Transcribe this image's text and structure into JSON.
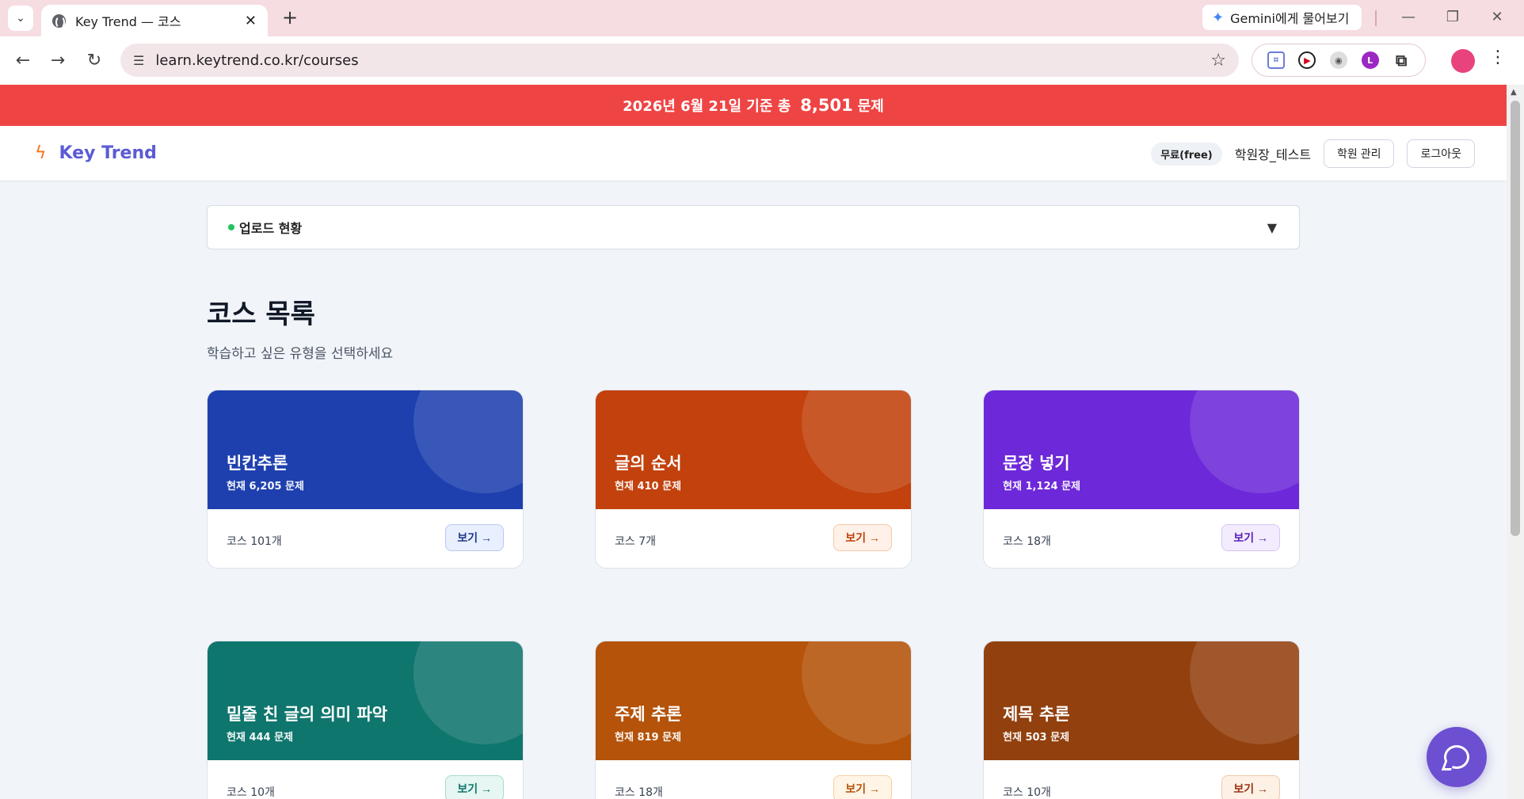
{
  "browser": {
    "tab_title": "Key Trend — 코스",
    "url": "learn.keytrend.co.kr/courses",
    "gemini_label": "Gemini에게 물어보기"
  },
  "banner": {
    "prefix": "2026년 6월 21일 기준 총",
    "count": "8,501",
    "suffix": "문제"
  },
  "header": {
    "logo": "Key Trend",
    "plan": "무료(free)",
    "user": "학원장_테스트",
    "manage_btn": "학원 관리",
    "logout_btn": "로그아웃"
  },
  "upload": {
    "label": "업로드 현황"
  },
  "page": {
    "title": "코스 목록",
    "subtitle": "학습하고 싶은 유형을 선택하세요"
  },
  "courses": [
    {
      "title": "빈칸추론",
      "count": "현재 6,205 문제",
      "courses": "코스 101개",
      "button": "보기 →",
      "color": "#1e40af",
      "btn_bg": "#e8efff",
      "btn_fg": "#1e3a8a",
      "btn_border": "#b8c8ef"
    },
    {
      "title": "글의 순서",
      "count": "현재 410 문제",
      "courses": "코스 7개",
      "button": "보기 →",
      "color": "#c2410c",
      "btn_bg": "#fff1e8",
      "btn_fg": "#c2410c",
      "btn_border": "#f6c6a8"
    },
    {
      "title": "문장 넣기",
      "count": "현재 1,124 문제",
      "courses": "코스 18개",
      "button": "보기 →",
      "color": "#6d28d9",
      "btn_bg": "#f3ecff",
      "btn_fg": "#5b21b6",
      "btn_border": "#d6c3f5"
    },
    {
      "title": "밑줄 친 글의 의미 파악",
      "count": "현재 444 문제",
      "courses": "코스 10개",
      "button": "보기 →",
      "color": "#0f766e",
      "btn_bg": "#e6f6f2",
      "btn_fg": "#0f766e",
      "btn_border": "#a9dccf"
    },
    {
      "title": "주제 추론",
      "count": "현재 819 문제",
      "courses": "코스 18개",
      "button": "보기 →",
      "color": "#b45309",
      "btn_bg": "#fff5e6",
      "btn_fg": "#b45309",
      "btn_border": "#f3d1a3"
    },
    {
      "title": "제목 추론",
      "count": "현재 503 문제",
      "courses": "코스 10개",
      "button": "보기 →",
      "color": "#92400e",
      "btn_bg": "#fdf1e6",
      "btn_fg": "#9a3412",
      "btn_border": "#eccaa9"
    }
  ]
}
